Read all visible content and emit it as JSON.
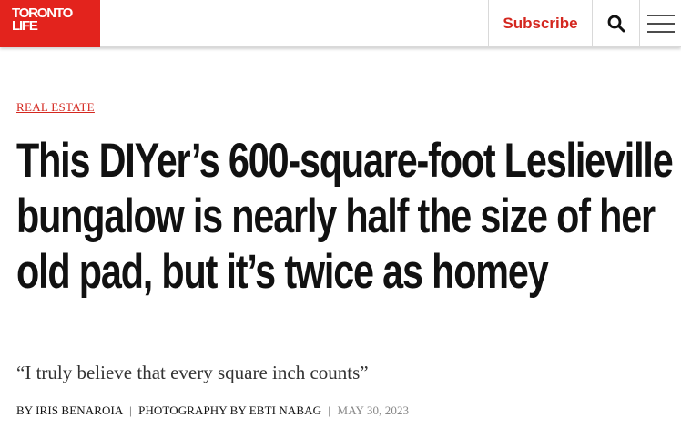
{
  "header": {
    "logo_line1": "TORONTO",
    "logo_line2": "LIFE",
    "subscribe_label": "Subscribe",
    "search_icon": "search-icon",
    "menu_icon": "hamburger-menu-icon",
    "brand_color": "#e3231d"
  },
  "article": {
    "category": "REAL ESTATE",
    "headline": "This DIYer’s 600-square-foot Leslieville bungalow is nearly half the size of her old pad, but it’s twice as homey",
    "dek": "“I truly believe that every square inch counts”",
    "author": "BY IRIS BENAROIA",
    "separator": "|",
    "photographer": "PHOTOGRAPHY BY EBTI NABAG",
    "date": "MAY 30, 2023"
  }
}
